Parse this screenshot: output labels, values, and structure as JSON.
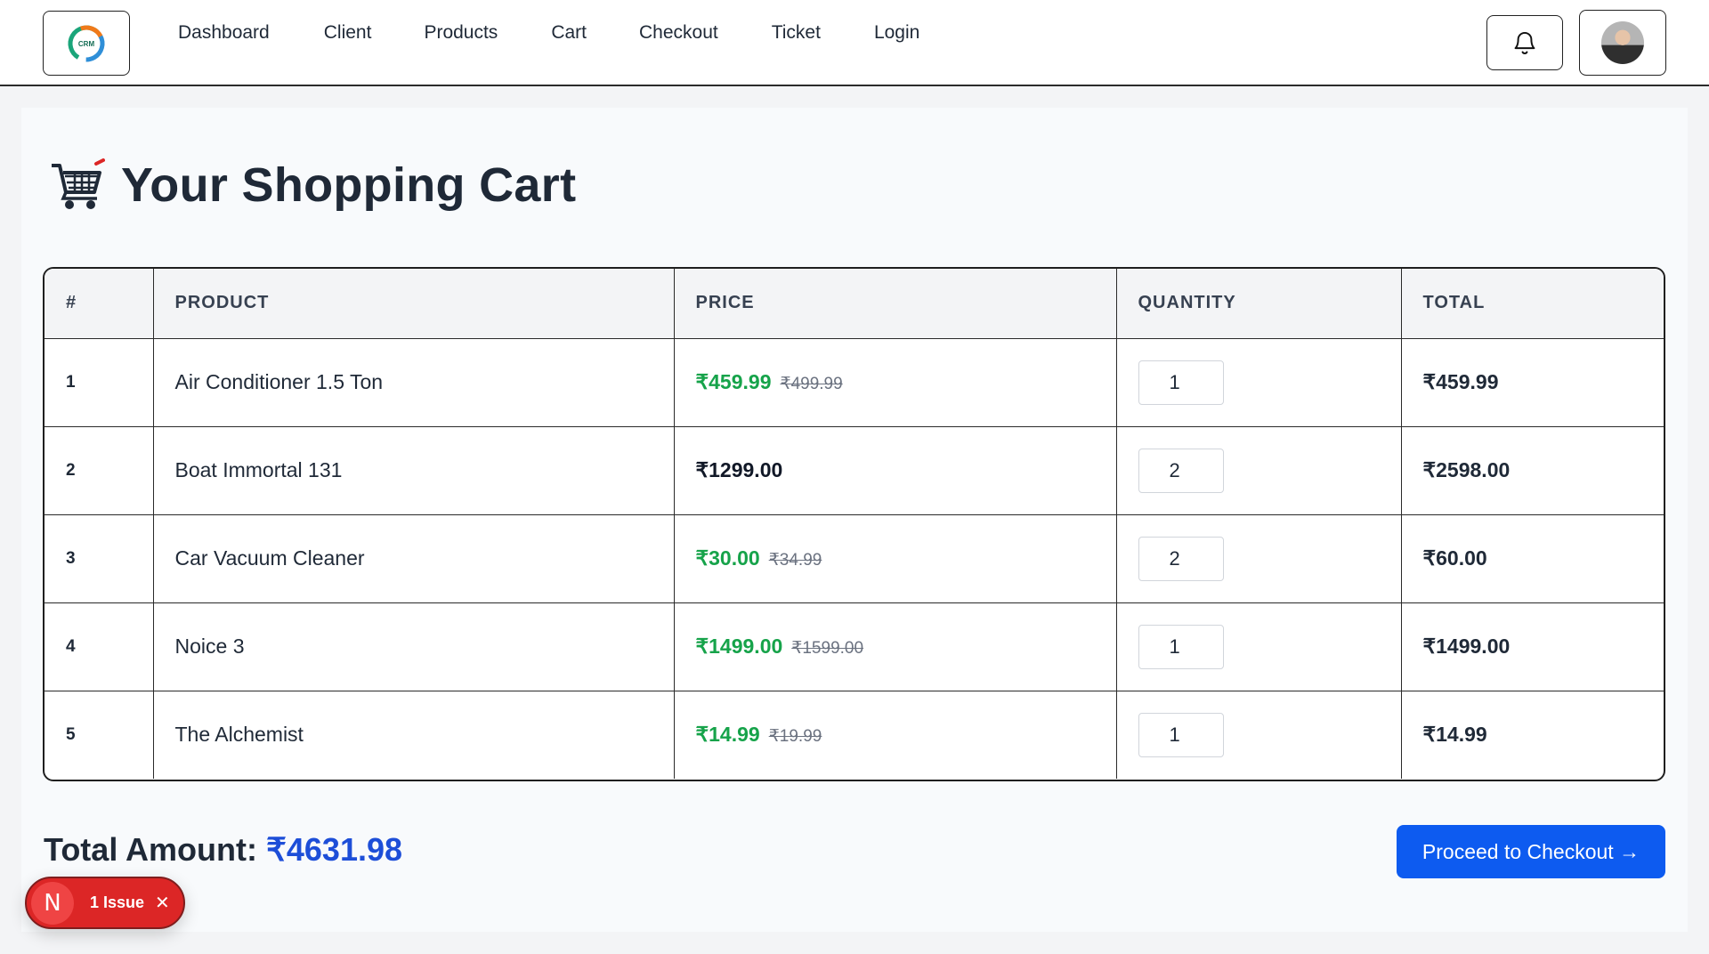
{
  "nav": {
    "logo_text": "CRM",
    "links": [
      "Dashboard",
      "Client",
      "Products",
      "Cart",
      "Checkout",
      "Ticket",
      "Login"
    ],
    "bell_icon": "bell-icon",
    "avatar_icon": "user-avatar"
  },
  "page": {
    "title": "Your Shopping Cart",
    "title_icon": "shopping-cart-icon"
  },
  "table": {
    "headers": [
      "#",
      "PRODUCT",
      "PRICE",
      "QUANTITY",
      "TOTAL"
    ],
    "rows": [
      {
        "idx": "1",
        "product": "Air Conditioner 1.5 Ton",
        "price": "₹459.99",
        "old_price": "₹499.99",
        "qty": "1",
        "total": "₹459.99"
      },
      {
        "idx": "2",
        "product": "Boat Immortal 131",
        "price": "₹1299.00",
        "old_price": "",
        "qty": "2",
        "total": "₹2598.00"
      },
      {
        "idx": "3",
        "product": "Car Vacuum Cleaner",
        "price": "₹30.00",
        "old_price": "₹34.99",
        "qty": "2",
        "total": "₹60.00"
      },
      {
        "idx": "4",
        "product": "Noice 3",
        "price": "₹1499.00",
        "old_price": "₹1599.00",
        "qty": "1",
        "total": "₹1499.00"
      },
      {
        "idx": "5",
        "product": "The Alchemist",
        "price": "₹14.99",
        "old_price": "₹19.99",
        "qty": "1",
        "total": "₹14.99"
      }
    ]
  },
  "summary": {
    "label": "Total Amount:",
    "amount": "₹4631.98",
    "checkout_label": "Proceed to Checkout →"
  },
  "issue_badge": {
    "letter": "N",
    "label": "1 Issue",
    "close": "✕"
  },
  "colors": {
    "accent": "#0d5bf0",
    "sale_price": "#16a34a",
    "total_amount": "#1d4ed8",
    "issue": "#dc2626"
  }
}
